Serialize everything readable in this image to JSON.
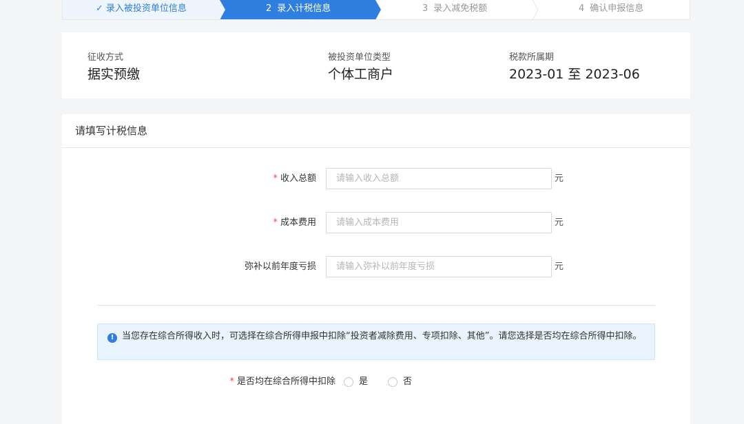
{
  "steps": [
    {
      "label": "录入被投资单位信息",
      "state": "done"
    },
    {
      "number": "2",
      "label": "录入计税信息",
      "state": "active"
    },
    {
      "number": "3",
      "label": "录入减免税额",
      "state": "pending"
    },
    {
      "number": "4",
      "label": "确认申报信息",
      "state": "pending"
    }
  ],
  "info": {
    "collection_method": {
      "label": "征收方式",
      "value": "据实预缴"
    },
    "investee_type": {
      "label": "被投资单位类型",
      "value": "个体工商户"
    },
    "tax_period": {
      "label": "税款所属期",
      "value": "2023-01 至 2023-06"
    }
  },
  "form": {
    "title": "请填写计税信息",
    "fields": [
      {
        "label": "收入总额",
        "required": true,
        "placeholder": "请输入收入总额",
        "value": "",
        "unit": "元"
      },
      {
        "label": "成本费用",
        "required": true,
        "placeholder": "请输入成本费用",
        "value": "",
        "unit": "元"
      },
      {
        "label": "弥补以前年度亏损",
        "required": false,
        "placeholder": "请输入弥补以前年度亏损",
        "value": "",
        "unit": "元"
      }
    ],
    "notice": "当您存在综合所得收入时，可选择在综合所得申报中扣除“投资者减除费用、专项扣除、其他”。请您选择是否均在综合所得中扣除。",
    "deduct_question": {
      "label": "是否均在综合所得中扣除",
      "required": true,
      "options": [
        "是",
        "否"
      ]
    }
  },
  "colors": {
    "accent": "#2f7fe0",
    "required": "#f04848",
    "notice_bg": "#e8f3fd"
  }
}
